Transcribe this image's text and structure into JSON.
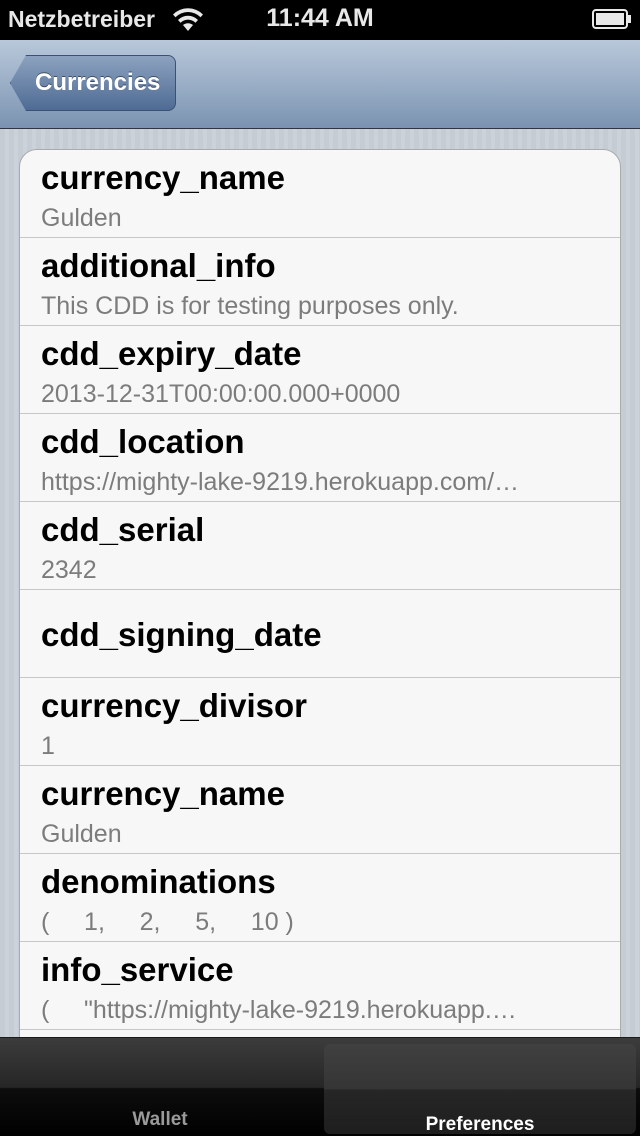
{
  "status_bar": {
    "carrier": "Netzbetreiber",
    "time": "11:44 AM",
    "icons": [
      "wifi-icon",
      "battery-icon"
    ]
  },
  "nav_bar": {
    "back_label": "Currencies"
  },
  "rows": [
    {
      "title": "currency_name",
      "value": "Gulden"
    },
    {
      "title": "additional_info",
      "value": "This CDD is for testing purposes only."
    },
    {
      "title": "cdd_expiry_date",
      "value": "2013-12-31T00:00:00.000+0000"
    },
    {
      "title": "cdd_location",
      "value": "https://mighty-lake-9219.herokuapp.com/…"
    },
    {
      "title": "cdd_serial",
      "value": "2342"
    },
    {
      "title": "cdd_signing_date",
      "value": ""
    },
    {
      "title": "currency_divisor",
      "value": "1"
    },
    {
      "title": "currency_name",
      "value": "Gulden"
    },
    {
      "title": "denominations",
      "value": "(     1,     2,     5,     10 )"
    },
    {
      "title": "info_service",
      "value": "(     \"https://mighty-lake-9219.herokuapp.…"
    }
  ],
  "tab_bar": {
    "tabs": [
      {
        "label": "Wallet",
        "selected": false
      },
      {
        "label": "Preferences",
        "selected": true
      }
    ]
  },
  "colors": {
    "nav_gradient_top": "#b9c8da",
    "nav_gradient_bottom": "#7b93b1",
    "back_button": "#5c7aa0",
    "value_text": "#7c7c7c"
  }
}
